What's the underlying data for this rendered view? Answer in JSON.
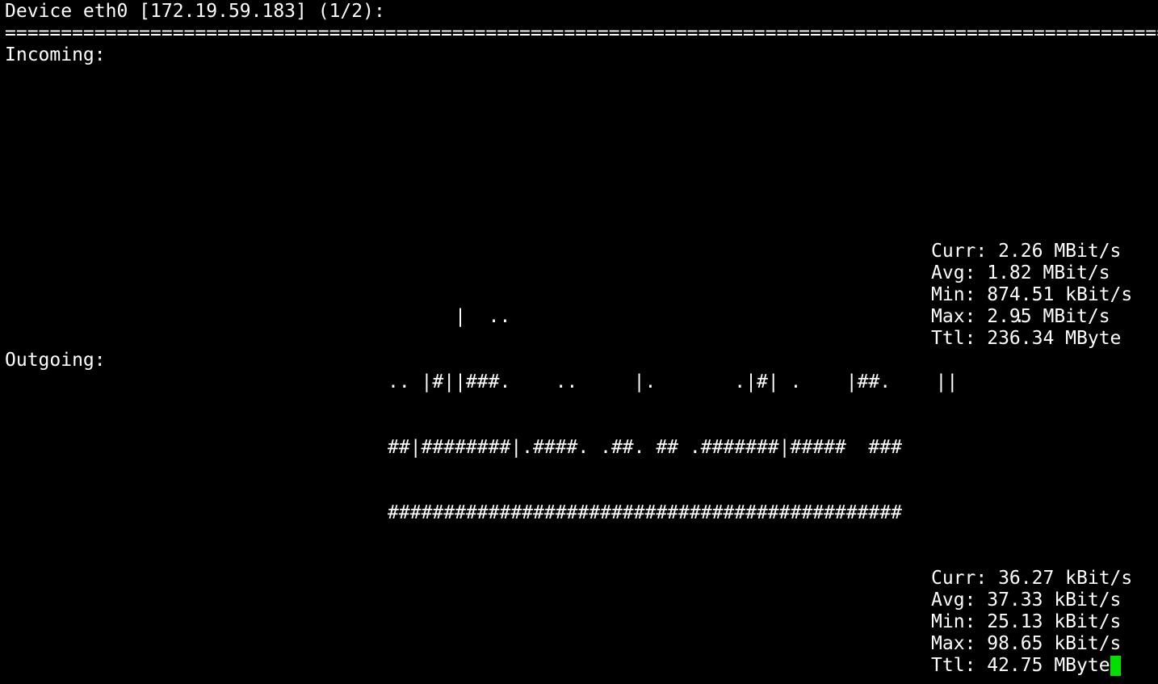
{
  "header": {
    "title": "Device eth0 [172.19.59.183] (1/2):",
    "separator": "================================================================================================================================"
  },
  "incoming": {
    "label": "Incoming:",
    "graph": [
      "      |  ..                                             .",
      ".. |#||###.    ..     |.       .|#| .    |##.    ||",
      "##|########|.####. .##. ## .#######|#####  ###",
      "##############################################"
    ],
    "stats": {
      "curr": "Curr: 2.26 MBit/s",
      "avg": "Avg: 1.82 MBit/s",
      "min": "Min: 874.51 kBit/s",
      "max": "Max: 2.95 MBit/s",
      "ttl": "Ttl: 236.34 MByte"
    }
  },
  "outgoing": {
    "label": "Outgoing:",
    "stats": {
      "curr": "Curr: 36.27 kBit/s",
      "avg": "Avg: 37.33 kBit/s",
      "min": "Min: 25.13 kBit/s",
      "max": "Max: 98.65 kBit/s",
      "ttl": "Ttl: 42.75 MByte"
    }
  },
  "colors": {
    "background": "#000000",
    "text": "#ffffff",
    "cursor": "#00e000"
  }
}
